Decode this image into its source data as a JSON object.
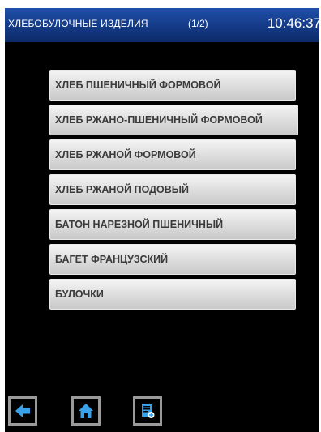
{
  "header": {
    "title": "ХЛЕБОБУЛОЧНЫЕ ИЗДЕЛИЯ",
    "page": "(1/2)",
    "time": "10:46:37"
  },
  "menu": {
    "items": [
      "ХЛЕБ ПШЕНИЧНЫЙ ФОРМОВОЙ",
      "ХЛЕБ РЖАНО-ПШЕНИЧНЫЙ ФОРМОВОЙ",
      "ХЛЕБ РЖАНОЙ ФОРМОВОЙ",
      "ХЛЕБ РЖАНОЙ ПОДОВЫЙ",
      "БАТОН НАРЕЗНОЙ ПШЕНИЧНЫЙ",
      "БАГЕТ ФРАНЦУЗСКИЙ",
      "БУЛОЧКИ"
    ]
  },
  "toolbar": {
    "icons": [
      "back-arrow-icon",
      "home-icon",
      "new-document-icon"
    ],
    "icon_color": "#3aa0e8"
  },
  "colors": {
    "header": "#143a86",
    "background": "#000000",
    "button_face": "#dcdcdc",
    "button_text": "#3b3b3b"
  }
}
